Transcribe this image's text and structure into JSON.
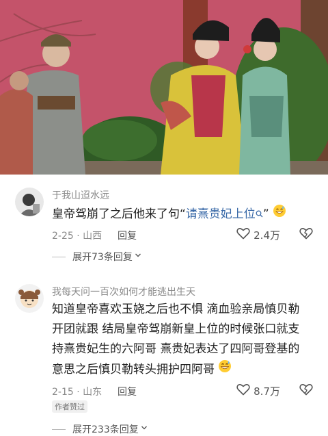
{
  "comments": [
    {
      "username": "于我山迢水远",
      "text_before": "皇帝驾崩了之后他来了句“",
      "text_link": "请熹贵妃上位",
      "text_after": "”",
      "date": "2-25",
      "location": "山西",
      "reply_label": "回复",
      "likes": "2.4万",
      "expand_label": "展开73条回复"
    },
    {
      "username": "我每天问一百次如何才能逃出生天",
      "lines": [
        "知道皇帝喜欢玉娆之后也不惧 滴血验亲局慎贝勒",
        "开团就跟 结局皇帝驾崩新皇上位的时候张口就支",
        "持熹贵妃生的六阿哥 熹贵妃表达了四阿哥登基的",
        "意思之后慎贝勒转头拥护四阿哥"
      ],
      "date": "2-15",
      "location": "山东",
      "reply_label": "回复",
      "likes": "8.7万",
      "badge": "作者赞过",
      "expand_label": "展开233条回复"
    }
  ],
  "colors": {
    "link": "#3a6aa8",
    "palace_wall": "#c9566e"
  },
  "icons": [
    "search-icon",
    "sweat-smile-icon",
    "grin-sweat-icon",
    "heart-icon",
    "dislike-icon",
    "chevron-down-icon"
  ]
}
